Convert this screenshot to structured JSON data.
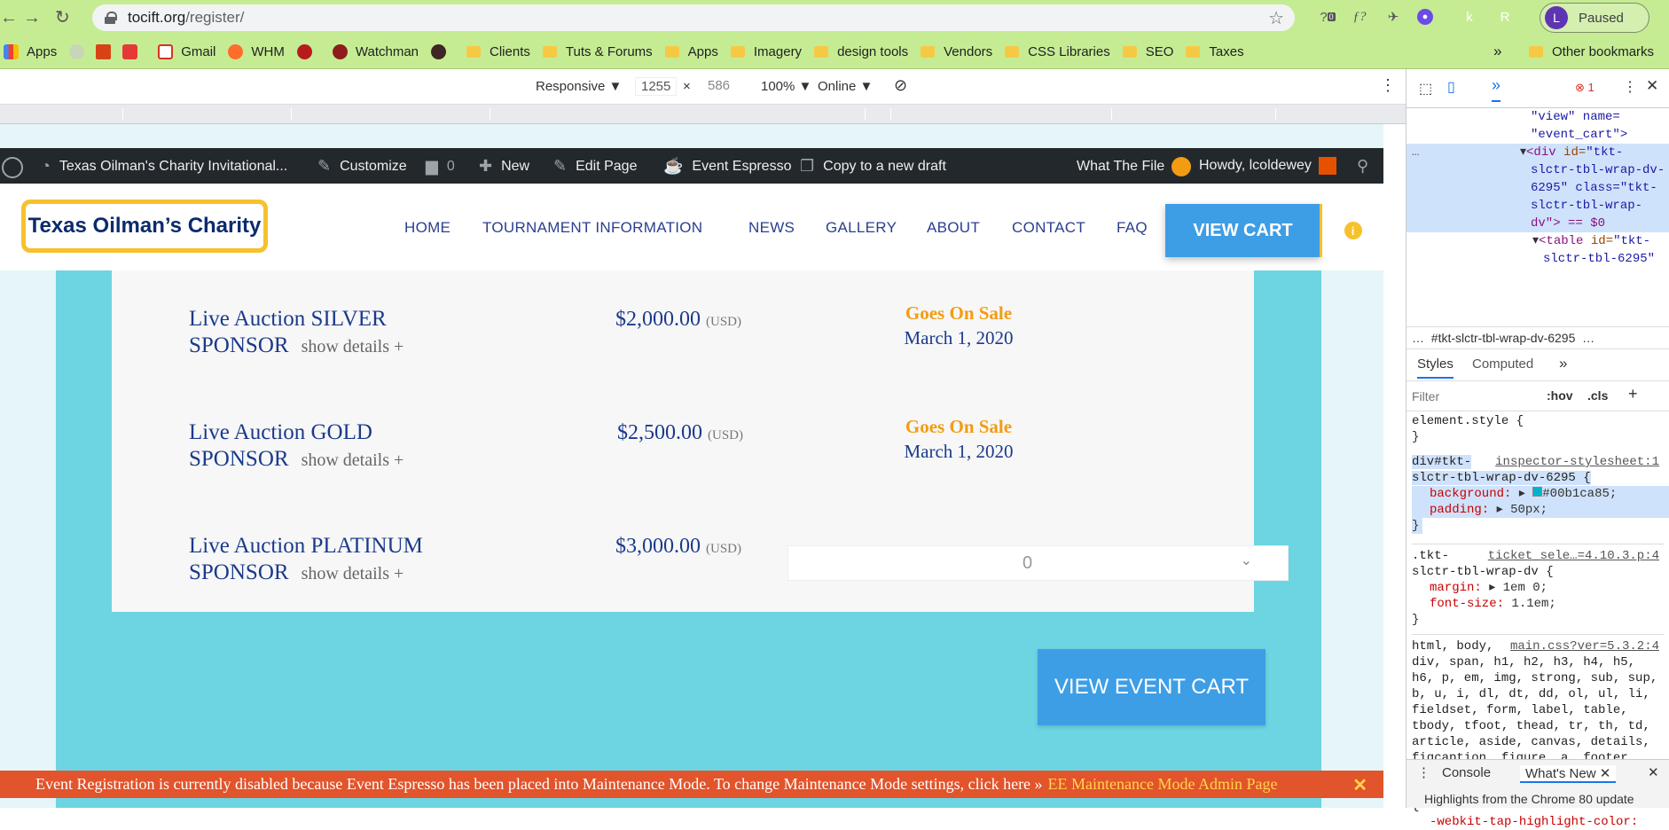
{
  "browser": {
    "url_host": "tocift.org",
    "url_path": "/register/",
    "profile_initial": "L",
    "profile_status": "Paused",
    "extension_badge": "0"
  },
  "bookmarks": [
    "Apps",
    "Gmail",
    "WHM",
    "Watchman",
    "Clients",
    "Tuts & Forums",
    "Apps",
    "Imagery",
    "design tools",
    "Vendors",
    "CSS Libraries",
    "SEO",
    "Taxes"
  ],
  "other_bookmarks": "Other bookmarks",
  "device_toolbar": {
    "mode": "Responsive ▼",
    "width": "1255",
    "times": "×",
    "height": "586",
    "zoom": "100% ▼",
    "network": "Online ▼"
  },
  "adminbar": {
    "site": "Texas Oilman's Charity Invitational...",
    "customize": "Customize",
    "comments": "0",
    "new": "New",
    "edit": "Edit Page",
    "espresso": "Event Espresso",
    "copy": "Copy to a new draft",
    "wtf": "What The File",
    "howdy": "Howdy, lcoldewey"
  },
  "header": {
    "logo": "Texas Oilman’s Charity",
    "menu": [
      "HOME",
      "TOURNAMENT INFORMATION",
      "NEWS",
      "GALLERY",
      "ABOUT",
      "CONTACT",
      "FAQ"
    ],
    "cart": "VIEW CART",
    "info": "i"
  },
  "tickets": [
    {
      "name": "Live Auction SILVER SPONSOR",
      "details": "show details +",
      "price": "$2,000.00",
      "currency": "(USD)",
      "status_a": "Goes On Sale",
      "status_b": "March 1, 2020"
    },
    {
      "name": "Live Auction GOLD SPONSOR",
      "details": "show details +",
      "price": "$2,500.00",
      "currency": "(USD)",
      "status_a": "Goes On Sale",
      "status_b": "March 1, 2020"
    },
    {
      "name": "Live Auction PLATINUM SPONSOR",
      "details": "show details +",
      "price": "$3,000.00",
      "currency": "(USD)",
      "qty": "0"
    }
  ],
  "view_event_cart": "VIEW EVENT CART",
  "notice": {
    "text": "Event Registration is currently disabled because Event Espresso has been placed into Maintenance Mode. To change Maintenance Mode settings, click here »",
    "link": "EE Maintenance Mode Admin Page",
    "close": "✕"
  },
  "devtools": {
    "error_count": "1",
    "dom": {
      "l1": "\"view\" name=",
      "l2": "\"event_cart\">",
      "l3_tag": "<div",
      "l3_attr": "id=",
      "l3_val": "\"tkt-",
      "l4": "slctr-tbl-wrap-dv-",
      "l5": "6295\" class=\"tkt-",
      "l6": "slctr-tbl-wrap-",
      "l7": "dv\"> == $0",
      "l8_tag": "<table",
      "l8_attr": "id=",
      "l8_val": "\"tkt-",
      "l9": "slctr-tbl-6295\""
    },
    "crumb": "#tkt-slctr-tbl-wrap-dv-6295",
    "tabs": [
      "Styles",
      "Computed"
    ],
    "filter_placeholder": "Filter",
    "hov": ":hov",
    "cls": ".cls",
    "rules": {
      "r1": "element.style {",
      "close": "}",
      "r2_sel": "div#tkt-slctr-tbl-wrap-dv-6295 {",
      "r2_src": "inspector-stylesheet:1",
      "r2_p1": "background:",
      "r2_v1": "#00b1ca85;",
      "r2_p2": "padding:",
      "r2_v2": "50px;",
      "r3_sel": ".tkt-slctr-tbl-wrap-dv {",
      "r3_src": "ticket_sele…=4.10.3.p:4",
      "r3_p1": "margin:",
      "r3_v1": "1em 0;",
      "r3_p2": "font-size:",
      "r3_v2": "1.1em;",
      "r4_src": "main.css?ver=5.3.2:4",
      "r4_sel": "html, body, div, span, h1, h2, h3, h4, h5, h6, p, em, img, strong, sub, sup, b, u, i, dl, dt, dd, ol, ul, li, fieldset, form, label, table, tbody, tfoot, thead, tr, th, td, article, aside, canvas, details, figcaption, figure, a, footer, header, menu, nav, section, summary, time, mark, audio, video {",
      "r4_p1": "-webkit-tap-highlight-color:"
    },
    "drawer_tabs": [
      "Console",
      "What's New"
    ],
    "drawer_text": "Highlights from the Chrome 80 update"
  },
  "colors": {
    "accent": "#3d9ee6",
    "teal": "#6dd4e2",
    "notice": "#e2542b",
    "logo_border": "#f6c12d"
  }
}
